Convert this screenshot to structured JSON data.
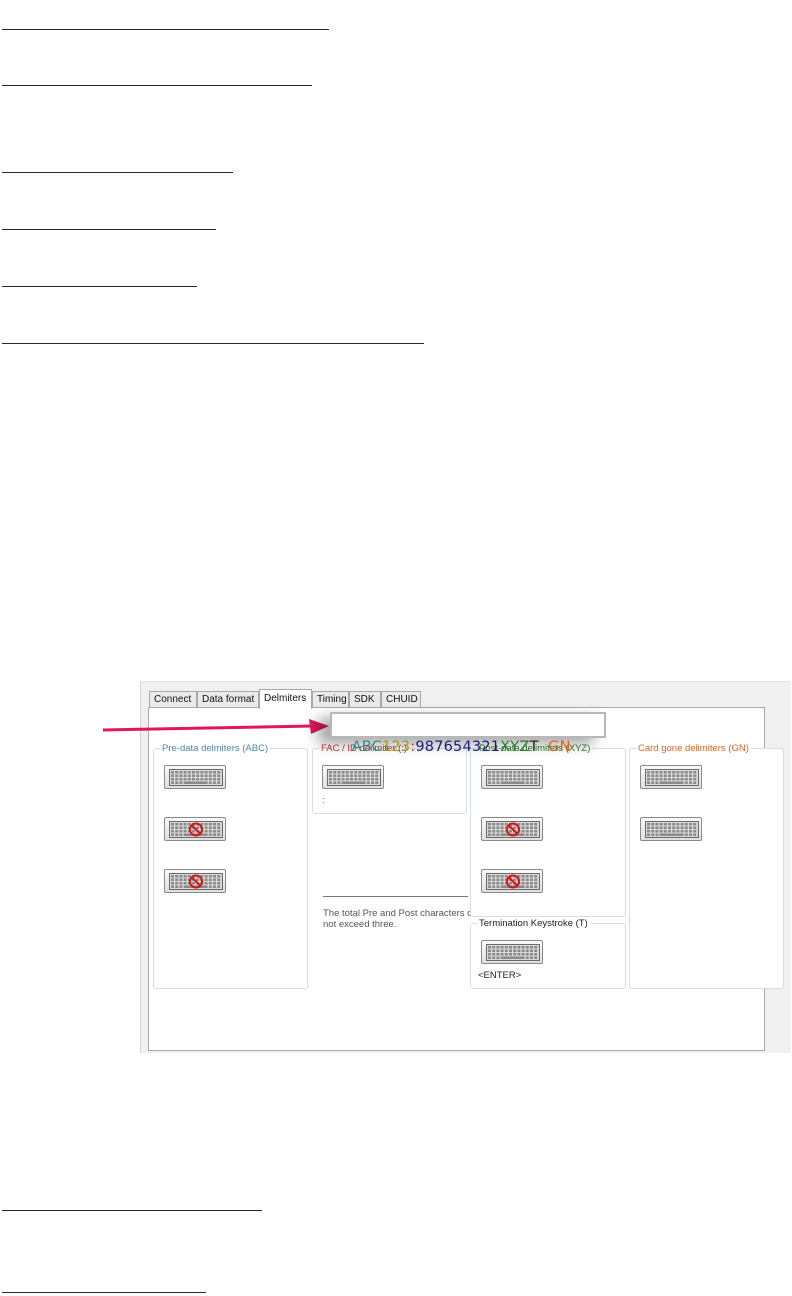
{
  "tabs": [
    "Connect",
    "Data format",
    "Delmiters",
    "Timing",
    "SDK",
    "CHUID"
  ],
  "active_tab": "Delmiters",
  "sample_string": {
    "parts": [
      {
        "text": "ABC",
        "color": "#2a8a8a"
      },
      {
        "text": "123",
        "color": "#9a9a1a"
      },
      {
        "text": ":",
        "color": "#cc2222"
      },
      {
        "text": "987654321",
        "color": "#1a1a7a"
      },
      {
        "text": "XYZ",
        "color": "#2a7a2a"
      },
      {
        "text": "T",
        "color": "#222222"
      },
      {
        "text": "  GN",
        "color": "#e0601a"
      }
    ]
  },
  "groups": {
    "pre": {
      "title": "Pre-data delmiters (ABC)",
      "color": "#4a86a8"
    },
    "fac": {
      "title": "FAC / ID delimiter (:)",
      "color": "#d03030",
      "value": ":"
    },
    "post": {
      "title": "Post-data delimiters (XYZ)",
      "color": "#2a7a2a"
    },
    "term": {
      "title": "Termination Keystroke (T)",
      "color": "#222222",
      "value": "<ENTER>"
    },
    "gone": {
      "title": "Card gone delimiters (GN)",
      "color": "#e06020"
    }
  },
  "note": "The total Pre and Post characters can not exceed three.",
  "colors": {
    "arrow": "#e0175a",
    "disabled": "#d01818"
  }
}
